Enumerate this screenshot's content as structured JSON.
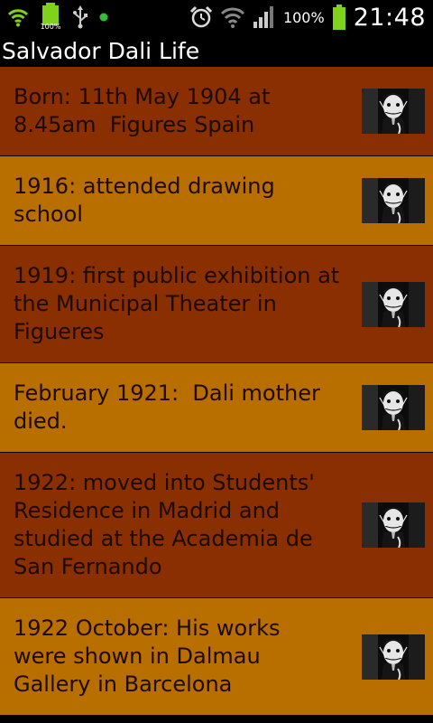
{
  "status_bar": {
    "battery_percent": "100%",
    "time": "21:48",
    "mini_battery_label": "100%",
    "icons": [
      "wifi-icon",
      "battery-charging-icon",
      "usb-icon",
      "notification-dot-icon",
      "alarm-icon",
      "wifi-signal-icon",
      "cell-signal-icon",
      "battery-icon"
    ]
  },
  "app": {
    "title": "Salvador Dali Life"
  },
  "timeline": [
    {
      "text": "Born: 11th May 1904 at\n8.45am  Figures Spain",
      "theme": "dark"
    },
    {
      "text": "1916: attended drawing\nschool",
      "theme": "light"
    },
    {
      "text": "1919: first public exhibition at\nthe Municipal Theater in\nFigueres",
      "theme": "dark"
    },
    {
      "text": "February 1921:  Dali mother\ndied.",
      "theme": "light"
    },
    {
      "text": "1922: moved into Students'\nResidence in Madrid and\nstudied at the Academia de\nSan Fernando",
      "theme": "dark"
    },
    {
      "text": "1922 October: His works\nwere shown in Dalmau\nGallery in Barcelona",
      "theme": "light"
    }
  ],
  "colors": {
    "dark_row": "#8a2f02",
    "light_row": "#b96e00",
    "status_green": "#7fd11b"
  }
}
